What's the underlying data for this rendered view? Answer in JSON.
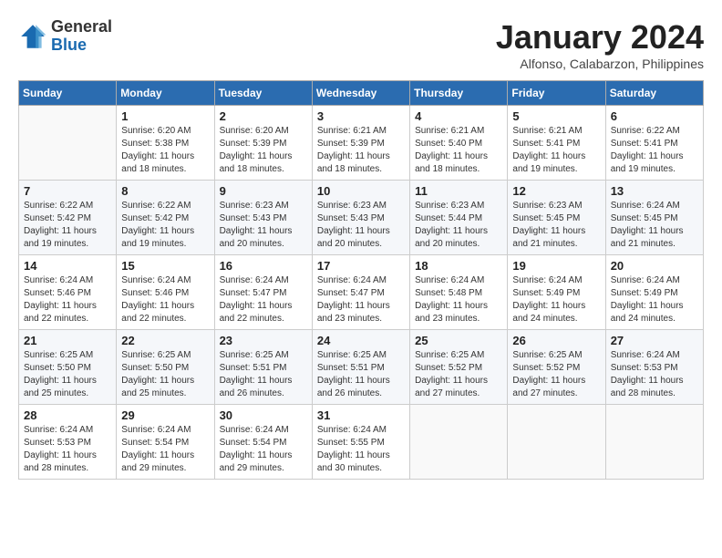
{
  "header": {
    "logo_general": "General",
    "logo_blue": "Blue",
    "month_title": "January 2024",
    "subtitle": "Alfonso, Calabarzon, Philippines"
  },
  "days_of_week": [
    "Sunday",
    "Monday",
    "Tuesday",
    "Wednesday",
    "Thursday",
    "Friday",
    "Saturday"
  ],
  "weeks": [
    [
      {
        "day": "",
        "info": ""
      },
      {
        "day": "1",
        "info": "Sunrise: 6:20 AM\nSunset: 5:38 PM\nDaylight: 11 hours\nand 18 minutes."
      },
      {
        "day": "2",
        "info": "Sunrise: 6:20 AM\nSunset: 5:39 PM\nDaylight: 11 hours\nand 18 minutes."
      },
      {
        "day": "3",
        "info": "Sunrise: 6:21 AM\nSunset: 5:39 PM\nDaylight: 11 hours\nand 18 minutes."
      },
      {
        "day": "4",
        "info": "Sunrise: 6:21 AM\nSunset: 5:40 PM\nDaylight: 11 hours\nand 18 minutes."
      },
      {
        "day": "5",
        "info": "Sunrise: 6:21 AM\nSunset: 5:41 PM\nDaylight: 11 hours\nand 19 minutes."
      },
      {
        "day": "6",
        "info": "Sunrise: 6:22 AM\nSunset: 5:41 PM\nDaylight: 11 hours\nand 19 minutes."
      }
    ],
    [
      {
        "day": "7",
        "info": "Sunrise: 6:22 AM\nSunset: 5:42 PM\nDaylight: 11 hours\nand 19 minutes."
      },
      {
        "day": "8",
        "info": "Sunrise: 6:22 AM\nSunset: 5:42 PM\nDaylight: 11 hours\nand 19 minutes."
      },
      {
        "day": "9",
        "info": "Sunrise: 6:23 AM\nSunset: 5:43 PM\nDaylight: 11 hours\nand 20 minutes."
      },
      {
        "day": "10",
        "info": "Sunrise: 6:23 AM\nSunset: 5:43 PM\nDaylight: 11 hours\nand 20 minutes."
      },
      {
        "day": "11",
        "info": "Sunrise: 6:23 AM\nSunset: 5:44 PM\nDaylight: 11 hours\nand 20 minutes."
      },
      {
        "day": "12",
        "info": "Sunrise: 6:23 AM\nSunset: 5:45 PM\nDaylight: 11 hours\nand 21 minutes."
      },
      {
        "day": "13",
        "info": "Sunrise: 6:24 AM\nSunset: 5:45 PM\nDaylight: 11 hours\nand 21 minutes."
      }
    ],
    [
      {
        "day": "14",
        "info": "Sunrise: 6:24 AM\nSunset: 5:46 PM\nDaylight: 11 hours\nand 22 minutes."
      },
      {
        "day": "15",
        "info": "Sunrise: 6:24 AM\nSunset: 5:46 PM\nDaylight: 11 hours\nand 22 minutes."
      },
      {
        "day": "16",
        "info": "Sunrise: 6:24 AM\nSunset: 5:47 PM\nDaylight: 11 hours\nand 22 minutes."
      },
      {
        "day": "17",
        "info": "Sunrise: 6:24 AM\nSunset: 5:47 PM\nDaylight: 11 hours\nand 23 minutes."
      },
      {
        "day": "18",
        "info": "Sunrise: 6:24 AM\nSunset: 5:48 PM\nDaylight: 11 hours\nand 23 minutes."
      },
      {
        "day": "19",
        "info": "Sunrise: 6:24 AM\nSunset: 5:49 PM\nDaylight: 11 hours\nand 24 minutes."
      },
      {
        "day": "20",
        "info": "Sunrise: 6:24 AM\nSunset: 5:49 PM\nDaylight: 11 hours\nand 24 minutes."
      }
    ],
    [
      {
        "day": "21",
        "info": "Sunrise: 6:25 AM\nSunset: 5:50 PM\nDaylight: 11 hours\nand 25 minutes."
      },
      {
        "day": "22",
        "info": "Sunrise: 6:25 AM\nSunset: 5:50 PM\nDaylight: 11 hours\nand 25 minutes."
      },
      {
        "day": "23",
        "info": "Sunrise: 6:25 AM\nSunset: 5:51 PM\nDaylight: 11 hours\nand 26 minutes."
      },
      {
        "day": "24",
        "info": "Sunrise: 6:25 AM\nSunset: 5:51 PM\nDaylight: 11 hours\nand 26 minutes."
      },
      {
        "day": "25",
        "info": "Sunrise: 6:25 AM\nSunset: 5:52 PM\nDaylight: 11 hours\nand 27 minutes."
      },
      {
        "day": "26",
        "info": "Sunrise: 6:25 AM\nSunset: 5:52 PM\nDaylight: 11 hours\nand 27 minutes."
      },
      {
        "day": "27",
        "info": "Sunrise: 6:24 AM\nSunset: 5:53 PM\nDaylight: 11 hours\nand 28 minutes."
      }
    ],
    [
      {
        "day": "28",
        "info": "Sunrise: 6:24 AM\nSunset: 5:53 PM\nDaylight: 11 hours\nand 28 minutes."
      },
      {
        "day": "29",
        "info": "Sunrise: 6:24 AM\nSunset: 5:54 PM\nDaylight: 11 hours\nand 29 minutes."
      },
      {
        "day": "30",
        "info": "Sunrise: 6:24 AM\nSunset: 5:54 PM\nDaylight: 11 hours\nand 29 minutes."
      },
      {
        "day": "31",
        "info": "Sunrise: 6:24 AM\nSunset: 5:55 PM\nDaylight: 11 hours\nand 30 minutes."
      },
      {
        "day": "",
        "info": ""
      },
      {
        "day": "",
        "info": ""
      },
      {
        "day": "",
        "info": ""
      }
    ]
  ]
}
